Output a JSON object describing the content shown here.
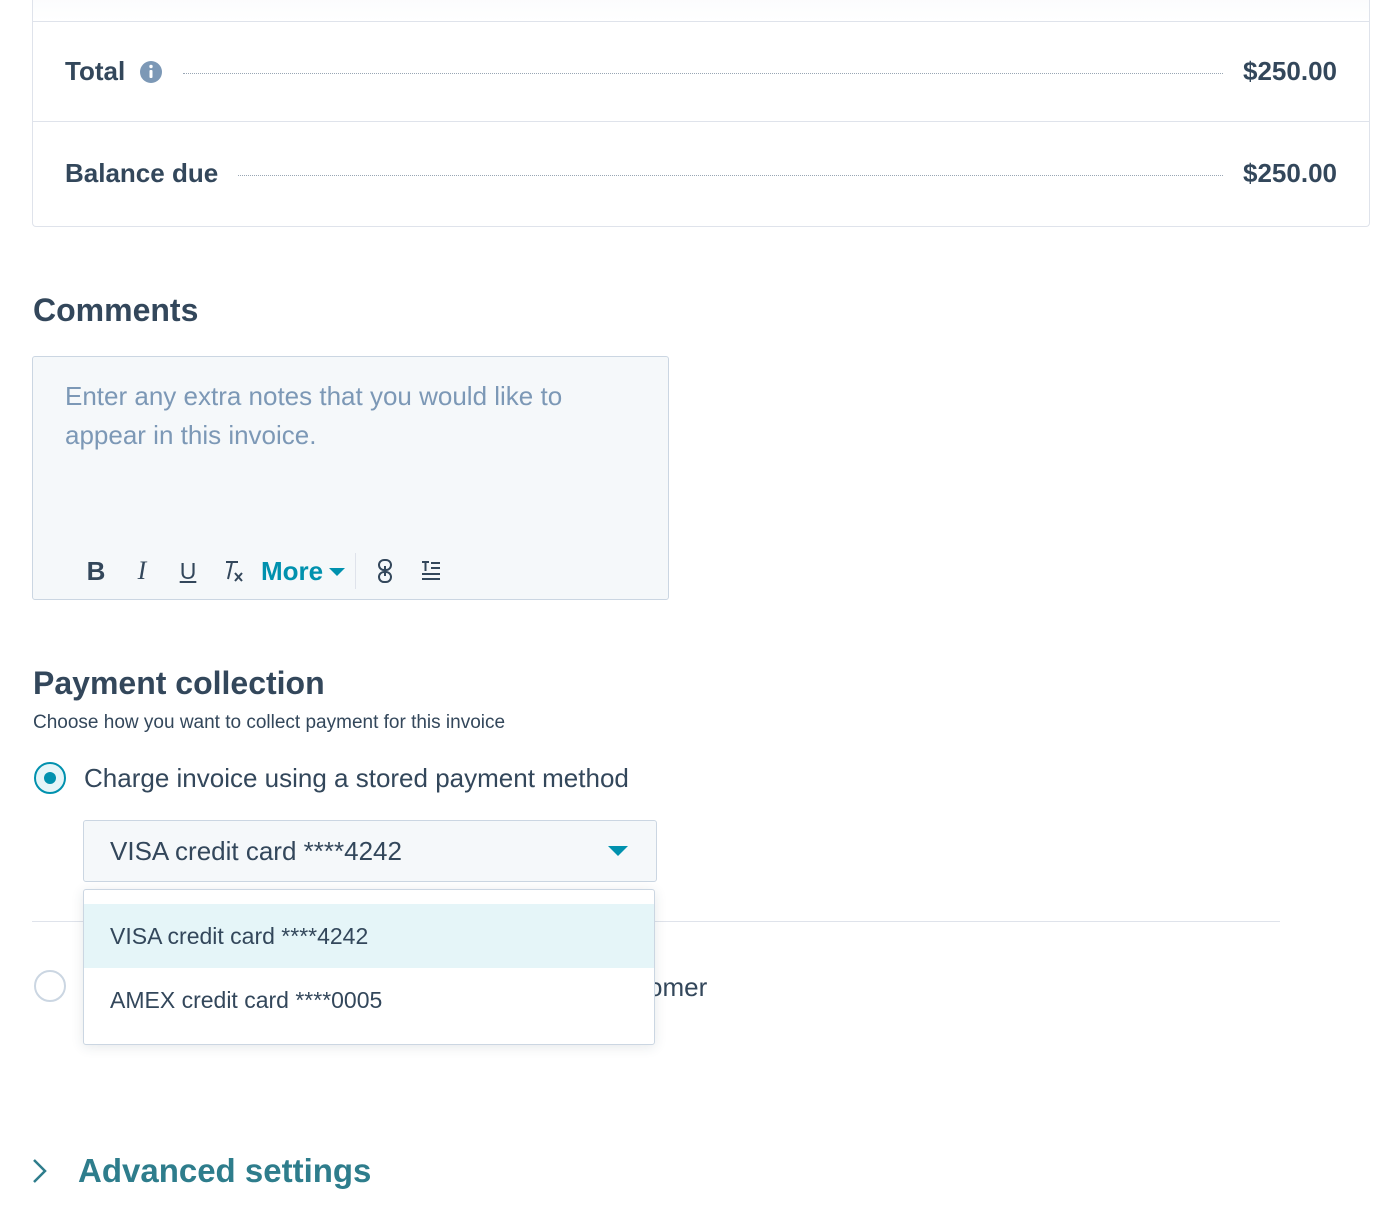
{
  "summary": {
    "total_label": "Total",
    "total_value": "$250.00",
    "balance_label": "Balance due",
    "balance_value": "$250.00"
  },
  "comments": {
    "title": "Comments",
    "placeholder": "Enter any extra notes that you would like to appear in this invoice.",
    "toolbar": {
      "bold": "B",
      "italic": "I",
      "underline": "U",
      "more_label": "More"
    }
  },
  "payment": {
    "title": "Payment collection",
    "subtitle": "Choose how you want to collect payment for this invoice",
    "option_stored_label": "Charge invoice using a stored payment method",
    "option_other_label_visible": "omer",
    "selected_method": "VISA credit card ****4242",
    "methods": [
      "VISA credit card ****4242",
      "AMEX credit card ****0005"
    ]
  },
  "advanced": {
    "label": "Advanced settings"
  },
  "colors": {
    "accent": "#0091ae",
    "text": "#33475b",
    "placeholder": "#7c98b6",
    "border": "#cbd6e2",
    "selected_bg": "#e5f5f8"
  }
}
